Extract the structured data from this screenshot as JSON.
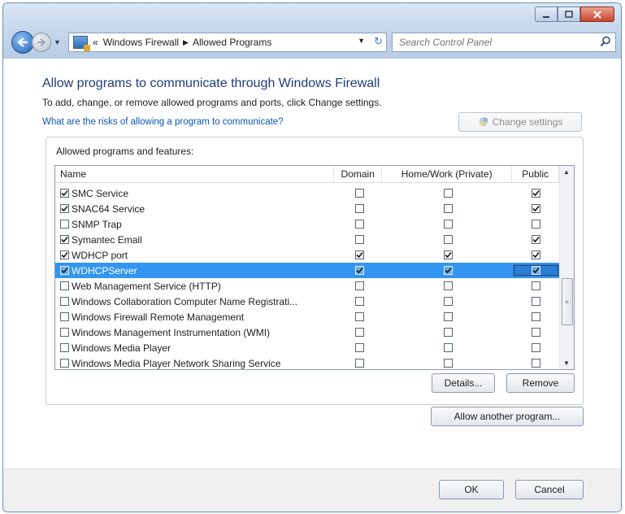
{
  "address": {
    "crumb_prefix": "«",
    "crumb1": "Windows Firewall",
    "crumb2": "Allowed Programs"
  },
  "search": {
    "placeholder": "Search Control Panel"
  },
  "heading": "Allow programs to communicate through Windows Firewall",
  "instructions": "To add, change, or remove allowed programs and ports, click Change settings.",
  "risk_link": "What are the risks of allowing a program to communicate?",
  "change_settings_label": "Change settings",
  "group_label": "Allowed programs and features:",
  "columns": {
    "name": "Name",
    "domain": "Domain",
    "home": "Home/Work (Private)",
    "public": "Public"
  },
  "programs": [
    {
      "label": "SMC Service",
      "enabled": true,
      "domain": false,
      "home": false,
      "public": true
    },
    {
      "label": "SNAC64 Service",
      "enabled": true,
      "domain": false,
      "home": false,
      "public": true
    },
    {
      "label": "SNMP Trap",
      "enabled": false,
      "domain": false,
      "home": false,
      "public": false
    },
    {
      "label": "Symantec Email",
      "enabled": true,
      "domain": false,
      "home": false,
      "public": true
    },
    {
      "label": "WDHCP port",
      "enabled": true,
      "domain": true,
      "home": true,
      "public": true
    },
    {
      "label": "WDHCPServer",
      "enabled": true,
      "domain": true,
      "home": true,
      "public": true,
      "selected": true
    },
    {
      "label": "Web Management Service (HTTP)",
      "enabled": false,
      "domain": false,
      "home": false,
      "public": false
    },
    {
      "label": "Windows Collaboration Computer Name Registrati...",
      "enabled": false,
      "domain": false,
      "home": false,
      "public": false
    },
    {
      "label": "Windows Firewall Remote Management",
      "enabled": false,
      "domain": false,
      "home": false,
      "public": false
    },
    {
      "label": "Windows Management Instrumentation (WMI)",
      "enabled": false,
      "domain": false,
      "home": false,
      "public": false
    },
    {
      "label": "Windows Media Player",
      "enabled": false,
      "domain": false,
      "home": false,
      "public": false
    },
    {
      "label": "Windows Media Player Network Sharing Service",
      "enabled": false,
      "domain": false,
      "home": false,
      "public": false
    }
  ],
  "buttons": {
    "details": "Details...",
    "remove": "Remove",
    "allow_another": "Allow another program...",
    "ok": "OK",
    "cancel": "Cancel"
  },
  "colors": {
    "heading": "#1e3d7b",
    "link": "#0b58b5",
    "selection": "#3296f0"
  }
}
